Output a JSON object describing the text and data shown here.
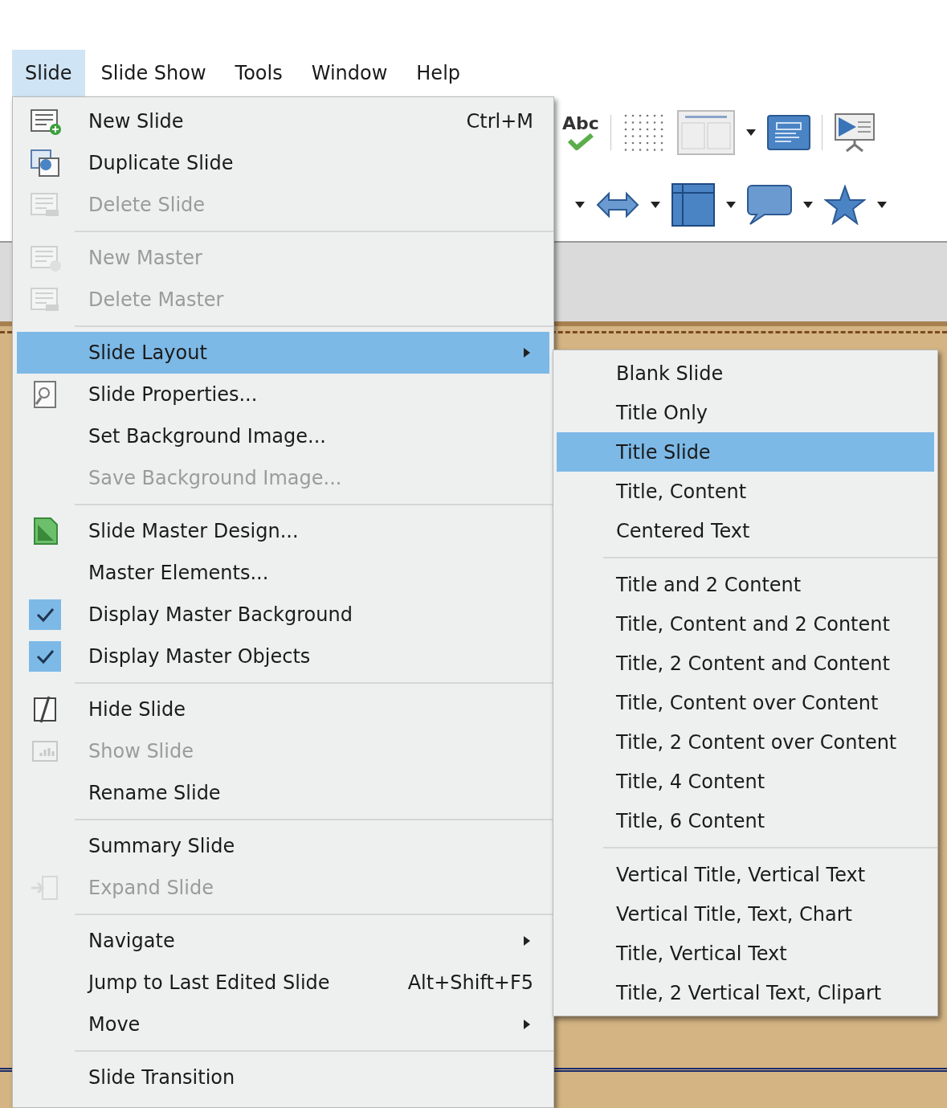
{
  "menubar": [
    {
      "label": "Slide",
      "selected": true
    },
    {
      "label": "Slide Show",
      "selected": false
    },
    {
      "label": "Tools",
      "selected": false
    },
    {
      "label": "Window",
      "selected": false
    },
    {
      "label": "Help",
      "selected": false
    }
  ],
  "toolbar": {
    "spelling_text": "Abc"
  },
  "menu": {
    "items": [
      {
        "kind": "item",
        "label": "New Slide",
        "shortcut": "Ctrl+M",
        "disabled": false,
        "checked": false,
        "submenu": false,
        "selected": false
      },
      {
        "kind": "item",
        "label": "Duplicate Slide",
        "disabled": false,
        "checked": false,
        "submenu": false,
        "selected": false
      },
      {
        "kind": "item",
        "label": "Delete Slide",
        "disabled": true,
        "checked": false,
        "submenu": false,
        "selected": false
      },
      {
        "kind": "separator"
      },
      {
        "kind": "item",
        "label": "New Master",
        "disabled": true,
        "checked": false,
        "submenu": false,
        "selected": false
      },
      {
        "kind": "item",
        "label": "Delete Master",
        "disabled": true,
        "checked": false,
        "submenu": false,
        "selected": false
      },
      {
        "kind": "separator"
      },
      {
        "kind": "item",
        "label": "Slide Layout",
        "disabled": false,
        "checked": false,
        "submenu": true,
        "selected": true
      },
      {
        "kind": "item",
        "label": "Slide Properties...",
        "disabled": false,
        "checked": false,
        "submenu": false,
        "selected": false
      },
      {
        "kind": "item",
        "label": "Set Background Image...",
        "disabled": false,
        "checked": false,
        "submenu": false,
        "selected": false
      },
      {
        "kind": "item",
        "label": "Save Background Image...",
        "disabled": true,
        "checked": false,
        "submenu": false,
        "selected": false
      },
      {
        "kind": "separator"
      },
      {
        "kind": "item",
        "label": "Slide Master Design...",
        "disabled": false,
        "checked": false,
        "submenu": false,
        "selected": false
      },
      {
        "kind": "item",
        "label": "Master Elements...",
        "disabled": false,
        "checked": false,
        "submenu": false,
        "selected": false
      },
      {
        "kind": "item",
        "label": "Display Master Background",
        "disabled": false,
        "checked": true,
        "submenu": false,
        "selected": false
      },
      {
        "kind": "item",
        "label": "Display Master Objects",
        "disabled": false,
        "checked": true,
        "submenu": false,
        "selected": false
      },
      {
        "kind": "separator"
      },
      {
        "kind": "item",
        "label": "Hide Slide",
        "disabled": false,
        "checked": false,
        "submenu": false,
        "selected": false
      },
      {
        "kind": "item",
        "label": "Show Slide",
        "disabled": true,
        "checked": false,
        "submenu": false,
        "selected": false
      },
      {
        "kind": "item",
        "label": "Rename Slide",
        "disabled": false,
        "checked": false,
        "submenu": false,
        "selected": false
      },
      {
        "kind": "separator"
      },
      {
        "kind": "item",
        "label": "Summary Slide",
        "disabled": false,
        "checked": false,
        "submenu": false,
        "selected": false
      },
      {
        "kind": "item",
        "label": "Expand Slide",
        "disabled": true,
        "checked": false,
        "submenu": false,
        "selected": false
      },
      {
        "kind": "separator"
      },
      {
        "kind": "item",
        "label": "Navigate",
        "disabled": false,
        "checked": false,
        "submenu": true,
        "selected": false
      },
      {
        "kind": "item",
        "label": "Jump to Last Edited Slide",
        "shortcut": "Alt+Shift+F5",
        "disabled": false,
        "checked": false,
        "submenu": false,
        "selected": false
      },
      {
        "kind": "item",
        "label": "Move",
        "disabled": false,
        "checked": false,
        "submenu": true,
        "selected": false
      },
      {
        "kind": "separator"
      },
      {
        "kind": "item",
        "label": "Slide Transition",
        "disabled": false,
        "checked": false,
        "submenu": false,
        "selected": false
      }
    ]
  },
  "submenu": {
    "items": [
      {
        "kind": "item",
        "label": "Blank Slide",
        "selected": false
      },
      {
        "kind": "item",
        "label": "Title Only",
        "selected": false
      },
      {
        "kind": "item",
        "label": "Title Slide",
        "selected": true
      },
      {
        "kind": "item",
        "label": "Title, Content",
        "selected": false
      },
      {
        "kind": "item",
        "label": "Centered Text",
        "selected": false
      },
      {
        "kind": "separator"
      },
      {
        "kind": "item",
        "label": "Title and 2 Content",
        "selected": false
      },
      {
        "kind": "item",
        "label": "Title, Content and 2 Content",
        "selected": false
      },
      {
        "kind": "item",
        "label": "Title, 2 Content and Content",
        "selected": false
      },
      {
        "kind": "item",
        "label": "Title, Content over Content",
        "selected": false
      },
      {
        "kind": "item",
        "label": "Title, 2 Content over Content",
        "selected": false
      },
      {
        "kind": "item",
        "label": "Title, 4 Content",
        "selected": false
      },
      {
        "kind": "item",
        "label": "Title, 6 Content",
        "selected": false
      },
      {
        "kind": "separator"
      },
      {
        "kind": "item",
        "label": "Vertical Title, Vertical Text",
        "selected": false
      },
      {
        "kind": "item",
        "label": "Vertical Title, Text, Chart",
        "selected": false
      },
      {
        "kind": "item",
        "label": "Title, Vertical Text",
        "selected": false
      },
      {
        "kind": "item",
        "label": "Title, 2 Vertical Text, Clipart",
        "selected": false
      }
    ]
  }
}
